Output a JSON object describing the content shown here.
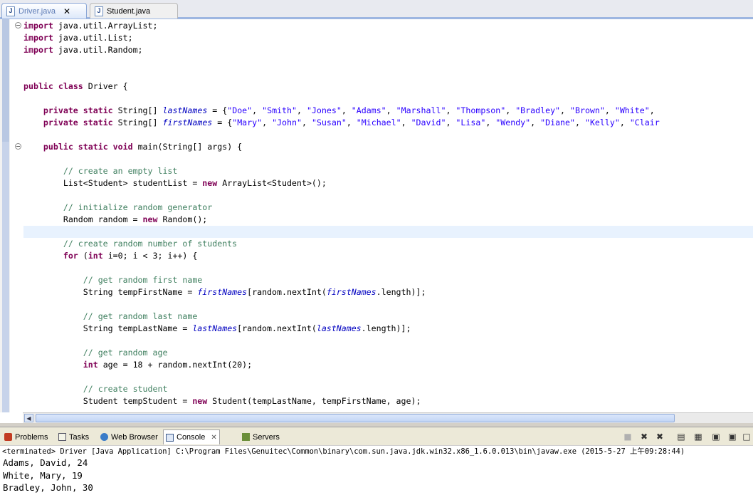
{
  "editor_tabs": [
    {
      "label": "Driver.java",
      "active": true,
      "icon": "java-file-icon"
    },
    {
      "label": "Student.java",
      "active": false,
      "icon": "java-file-icon"
    }
  ],
  "code_lines": [
    [
      {
        "t": "kw",
        "s": "import"
      },
      {
        "t": "tx",
        "s": " java.util.ArrayList;"
      }
    ],
    [
      {
        "t": "kw",
        "s": "import"
      },
      {
        "t": "tx",
        "s": " java.util.List;"
      }
    ],
    [
      {
        "t": "kw",
        "s": "import"
      },
      {
        "t": "tx",
        "s": " java.util.Random;"
      }
    ],
    [],
    [],
    [
      {
        "t": "kw",
        "s": "public"
      },
      {
        "t": "tx",
        "s": " "
      },
      {
        "t": "kw",
        "s": "class"
      },
      {
        "t": "tx",
        "s": " Driver {"
      }
    ],
    [],
    [
      {
        "t": "tx",
        "s": "    "
      },
      {
        "t": "kw",
        "s": "private"
      },
      {
        "t": "tx",
        "s": " "
      },
      {
        "t": "kw",
        "s": "static"
      },
      {
        "t": "tx",
        "s": " String[] "
      },
      {
        "t": "fld",
        "s": "lastNames"
      },
      {
        "t": "tx",
        "s": " = {"
      },
      {
        "t": "str",
        "s": "\"Doe\""
      },
      {
        "t": "tx",
        "s": ", "
      },
      {
        "t": "str",
        "s": "\"Smith\""
      },
      {
        "t": "tx",
        "s": ", "
      },
      {
        "t": "str",
        "s": "\"Jones\""
      },
      {
        "t": "tx",
        "s": ", "
      },
      {
        "t": "str",
        "s": "\"Adams\""
      },
      {
        "t": "tx",
        "s": ", "
      },
      {
        "t": "str",
        "s": "\"Marshall\""
      },
      {
        "t": "tx",
        "s": ", "
      },
      {
        "t": "str",
        "s": "\"Thompson\""
      },
      {
        "t": "tx",
        "s": ", "
      },
      {
        "t": "str",
        "s": "\"Bradley\""
      },
      {
        "t": "tx",
        "s": ", "
      },
      {
        "t": "str",
        "s": "\"Brown\""
      },
      {
        "t": "tx",
        "s": ", "
      },
      {
        "t": "str",
        "s": "\"White\""
      },
      {
        "t": "tx",
        "s": ","
      }
    ],
    [
      {
        "t": "tx",
        "s": "    "
      },
      {
        "t": "kw",
        "s": "private"
      },
      {
        "t": "tx",
        "s": " "
      },
      {
        "t": "kw",
        "s": "static"
      },
      {
        "t": "tx",
        "s": " String[] "
      },
      {
        "t": "fld",
        "s": "firstNames"
      },
      {
        "t": "tx",
        "s": " = {"
      },
      {
        "t": "str",
        "s": "\"Mary\""
      },
      {
        "t": "tx",
        "s": ", "
      },
      {
        "t": "str",
        "s": "\"John\""
      },
      {
        "t": "tx",
        "s": ", "
      },
      {
        "t": "str",
        "s": "\"Susan\""
      },
      {
        "t": "tx",
        "s": ", "
      },
      {
        "t": "str",
        "s": "\"Michael\""
      },
      {
        "t": "tx",
        "s": ", "
      },
      {
        "t": "str",
        "s": "\"David\""
      },
      {
        "t": "tx",
        "s": ", "
      },
      {
        "t": "str",
        "s": "\"Lisa\""
      },
      {
        "t": "tx",
        "s": ", "
      },
      {
        "t": "str",
        "s": "\"Wendy\""
      },
      {
        "t": "tx",
        "s": ", "
      },
      {
        "t": "str",
        "s": "\"Diane\""
      },
      {
        "t": "tx",
        "s": ", "
      },
      {
        "t": "str",
        "s": "\"Kelly\""
      },
      {
        "t": "tx",
        "s": ", "
      },
      {
        "t": "str",
        "s": "\"Clair"
      }
    ],
    [],
    [
      {
        "t": "tx",
        "s": "    "
      },
      {
        "t": "kw",
        "s": "public"
      },
      {
        "t": "tx",
        "s": " "
      },
      {
        "t": "kw",
        "s": "static"
      },
      {
        "t": "tx",
        "s": " "
      },
      {
        "t": "kw",
        "s": "void"
      },
      {
        "t": "tx",
        "s": " main(String[] args) {"
      }
    ],
    [],
    [
      {
        "t": "tx",
        "s": "        "
      },
      {
        "t": "cm",
        "s": "// create an empty list"
      }
    ],
    [
      {
        "t": "tx",
        "s": "        List<Student> studentList = "
      },
      {
        "t": "kw",
        "s": "new"
      },
      {
        "t": "tx",
        "s": " ArrayList<Student>();"
      }
    ],
    [],
    [
      {
        "t": "tx",
        "s": "        "
      },
      {
        "t": "cm",
        "s": "// initialize random generator"
      }
    ],
    [
      {
        "t": "tx",
        "s": "        Random random = "
      },
      {
        "t": "kw",
        "s": "new"
      },
      {
        "t": "tx",
        "s": " Random();"
      }
    ],
    [],
    [
      {
        "t": "tx",
        "s": "        "
      },
      {
        "t": "cm",
        "s": "// create random number of students"
      }
    ],
    [
      {
        "t": "tx",
        "s": "        "
      },
      {
        "t": "kw",
        "s": "for"
      },
      {
        "t": "tx",
        "s": " ("
      },
      {
        "t": "kw",
        "s": "int"
      },
      {
        "t": "tx",
        "s": " i=0; i < 3; i++) {"
      }
    ],
    [],
    [
      {
        "t": "tx",
        "s": "            "
      },
      {
        "t": "cm",
        "s": "// get random first name"
      }
    ],
    [
      {
        "t": "tx",
        "s": "            String tempFirstName = "
      },
      {
        "t": "fld",
        "s": "firstNames"
      },
      {
        "t": "tx",
        "s": "[random.nextInt("
      },
      {
        "t": "fld",
        "s": "firstNames"
      },
      {
        "t": "tx",
        "s": ".length)];"
      }
    ],
    [],
    [
      {
        "t": "tx",
        "s": "            "
      },
      {
        "t": "cm",
        "s": "// get random last name"
      }
    ],
    [
      {
        "t": "tx",
        "s": "            String tempLastName = "
      },
      {
        "t": "fld",
        "s": "lastNames"
      },
      {
        "t": "tx",
        "s": "[random.nextInt("
      },
      {
        "t": "fld",
        "s": "lastNames"
      },
      {
        "t": "tx",
        "s": ".length)];"
      }
    ],
    [],
    [
      {
        "t": "tx",
        "s": "            "
      },
      {
        "t": "cm",
        "s": "// get random age"
      }
    ],
    [
      {
        "t": "tx",
        "s": "            "
      },
      {
        "t": "kw",
        "s": "int"
      },
      {
        "t": "tx",
        "s": " age = 18 + random.nextInt(20);"
      }
    ],
    [],
    [
      {
        "t": "tx",
        "s": "            "
      },
      {
        "t": "cm",
        "s": "// create student"
      }
    ],
    [
      {
        "t": "tx",
        "s": "            Student tempStudent = "
      },
      {
        "t": "kw",
        "s": "new"
      },
      {
        "t": "tx",
        "s": " Student(tempLastName, tempFirstName, age);"
      }
    ]
  ],
  "highlighted_line": 17,
  "fold_markers": [
    0,
    10
  ],
  "console_tabs": [
    {
      "label": "Problems",
      "icon": "problems-icon"
    },
    {
      "label": "Tasks",
      "icon": "tasks-icon"
    },
    {
      "label": "Web Browser",
      "icon": "globe-icon"
    },
    {
      "label": "Console",
      "icon": "console-icon",
      "active": true
    },
    {
      "label": "Servers",
      "icon": "servers-icon"
    }
  ],
  "console_status": "<terminated> Driver [Java Application] C:\\Program Files\\Genuitec\\Common\\binary\\com.sun.java.jdk.win32.x86_1.6.0.013\\bin\\javaw.exe (2015-5-27 上午09:28:44)",
  "console_output": [
    "Adams, David, 24",
    "White, Mary, 19",
    "Bradley, John, 30"
  ],
  "colors": {
    "keyword": "#7f0055",
    "string": "#2a00ff",
    "comment": "#3f7f5f",
    "field": "#0000c0",
    "current_line": "#e8f2fe"
  }
}
